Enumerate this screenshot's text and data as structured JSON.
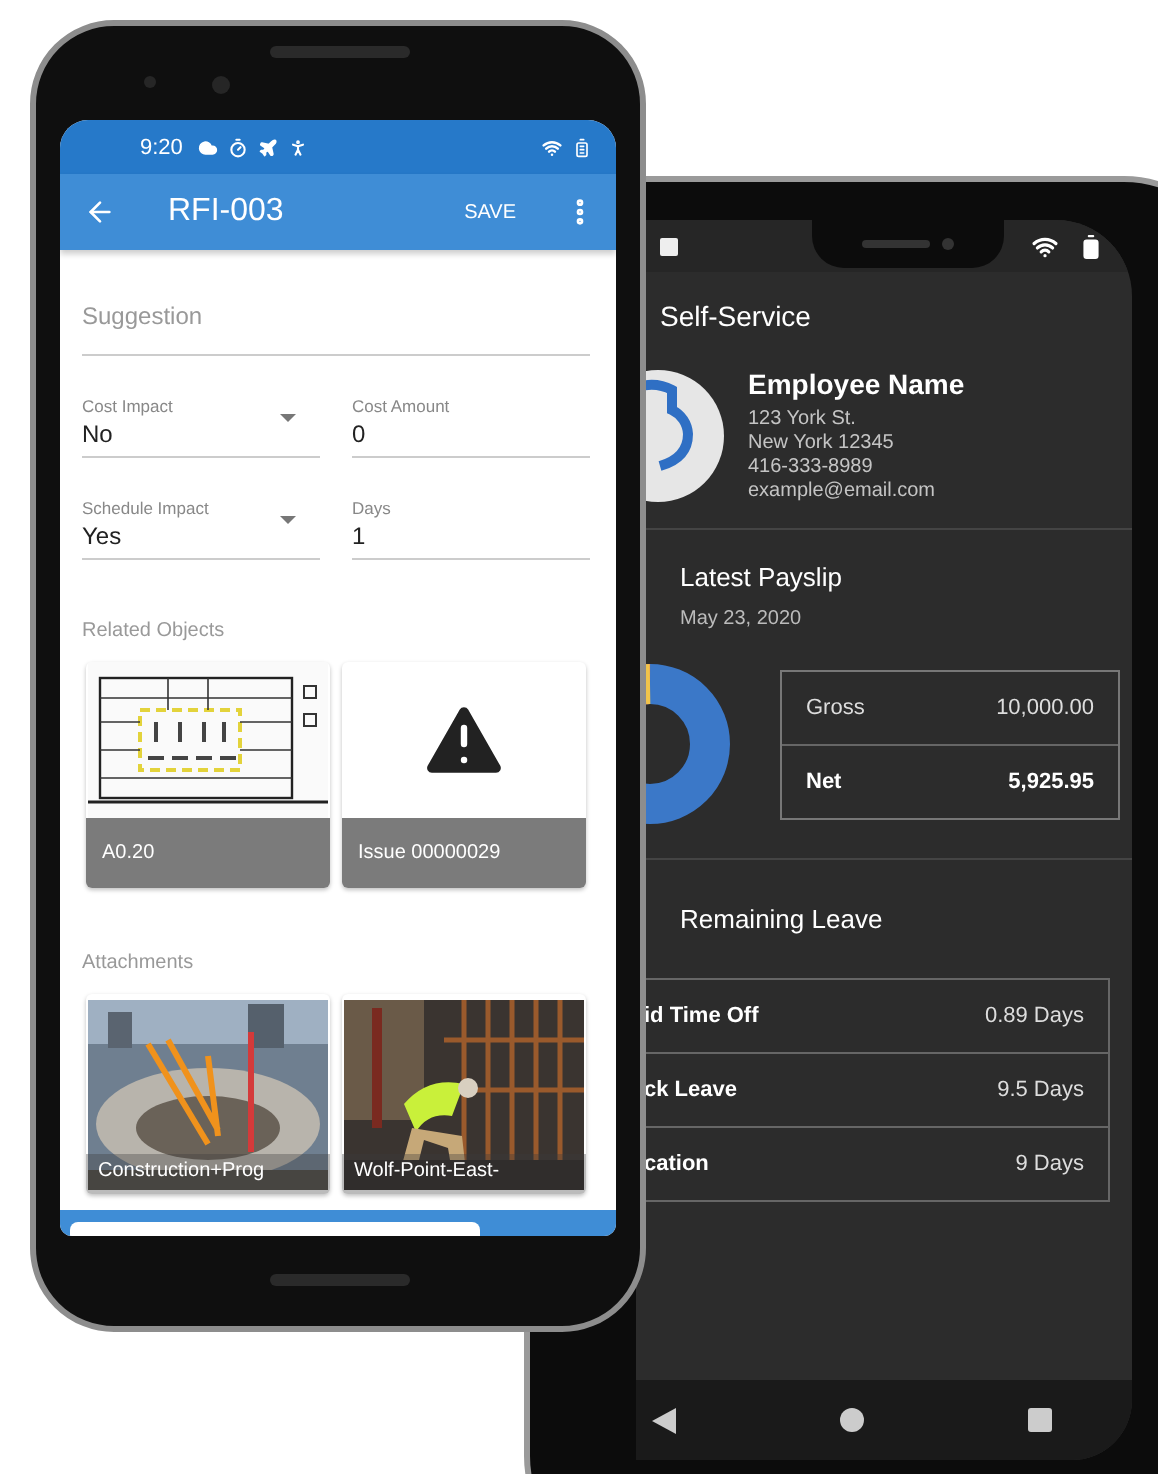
{
  "rfi_screen": {
    "status_bar": {
      "time": "9:20"
    },
    "app_bar": {
      "title": "RFI-003",
      "action": "SAVE"
    },
    "suggestion": {
      "placeholder": "Suggestion"
    },
    "field_rows": [
      [
        {
          "kind": "dropdown",
          "label": "Cost Impact",
          "value": "No"
        },
        {
          "kind": "text",
          "label": "Cost Amount",
          "value": "0"
        }
      ],
      [
        {
          "kind": "dropdown",
          "label": "Schedule Impact",
          "value": "Yes"
        },
        {
          "kind": "text",
          "label": "Days",
          "value": "1"
        }
      ]
    ],
    "related_objects": {
      "heading": "Related Objects",
      "items": [
        {
          "kind": "plan",
          "caption": "A0.20"
        },
        {
          "kind": "issue",
          "caption": "Issue 00000029"
        }
      ]
    },
    "attachments": {
      "heading": "Attachments",
      "items": [
        {
          "kind": "stadium",
          "caption": "Construction+Prog"
        },
        {
          "kind": "worker",
          "caption": "Wolf-Point-East-"
        }
      ]
    }
  },
  "self_service_screen": {
    "title": "Self-Service",
    "profile": {
      "name": "Employee Name",
      "details": [
        "123 York St.",
        "New York 12345",
        "416-333-8989",
        "example@email.com"
      ]
    },
    "payslip": {
      "heading": "Latest Payslip",
      "date": "May 23, 2020",
      "rows": [
        {
          "kind": "line",
          "label": "Gross",
          "value": "10,000.00"
        },
        {
          "kind": "total",
          "label": "Net",
          "value": "5,925.95"
        }
      ]
    },
    "leave": {
      "heading": "Remaining Leave",
      "rows": [
        {
          "label": "id Time Off",
          "value": "0.89 Days"
        },
        {
          "label": "ck Leave",
          "value": "9.5 Days"
        },
        {
          "label": "cation",
          "value": "9 Days"
        }
      ]
    }
  }
}
